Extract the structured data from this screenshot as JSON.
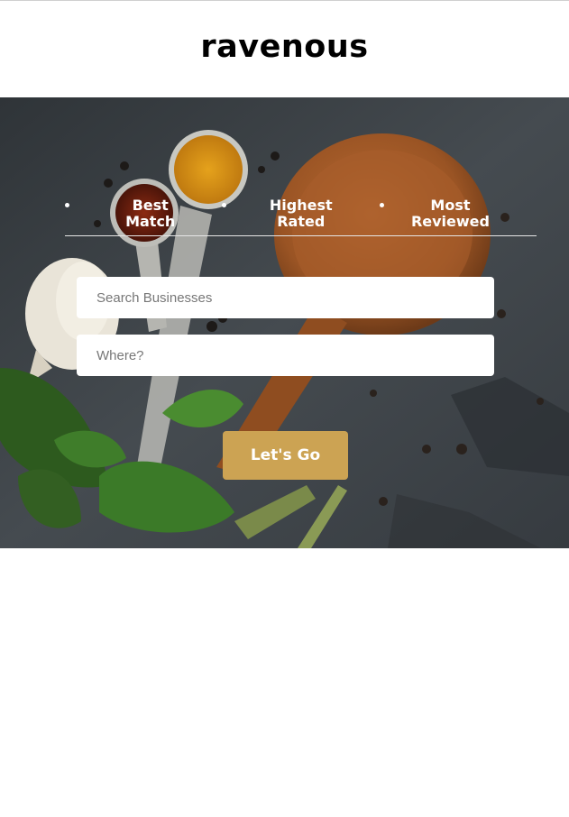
{
  "app": {
    "brand": "ravenous"
  },
  "sort_options": [
    {
      "label_line1": "Best",
      "label_line2": "Match"
    },
    {
      "label_line1": "Highest",
      "label_line2": "Rated"
    },
    {
      "label_line1": "Most",
      "label_line2": "Reviewed"
    }
  ],
  "search": {
    "term_placeholder": "Search Businesses",
    "location_placeholder": "Where?"
  },
  "actions": {
    "go_label": "Let's Go"
  },
  "colors": {
    "button": "#cca353",
    "hero_bg": "#3a4046"
  }
}
